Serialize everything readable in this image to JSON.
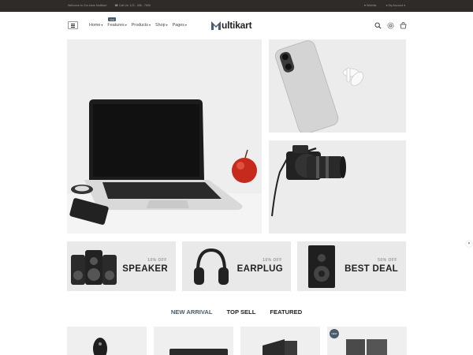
{
  "topbar": {
    "welcome": "Welcome to Our store Multikart",
    "phone": "Call Us: 123 - 456 - 7890",
    "wishlist": "Wishlist",
    "account": "My Account"
  },
  "header": {
    "nav": [
      {
        "label": "Home"
      },
      {
        "label": "Features",
        "badge": "new"
      },
      {
        "label": "Products"
      },
      {
        "label": "Shop"
      },
      {
        "label": "Pages"
      }
    ],
    "logo_text": "ultikart",
    "icons": [
      "search-icon",
      "settings-icon",
      "cart-icon"
    ]
  },
  "banners": [
    {
      "discount": "10% OFF",
      "title": "SPEAKER"
    },
    {
      "discount": "10% OFF",
      "title": "EARPLUG"
    },
    {
      "discount": "50% OFF",
      "title": "BEST DEAL"
    }
  ],
  "tabs": [
    {
      "label": "NEW ARRIVAL"
    },
    {
      "label": "TOP SELL"
    },
    {
      "label": "FEATURED"
    }
  ],
  "products": [
    {
      "badge": ""
    },
    {
      "badge": ""
    },
    {
      "badge": ""
    },
    {
      "badge": "NEW"
    }
  ],
  "colors": {
    "topbar": "#2f2b29",
    "accent": "#4a5b6c",
    "tile": "#eeeeee"
  },
  "close_glyph": "×"
}
